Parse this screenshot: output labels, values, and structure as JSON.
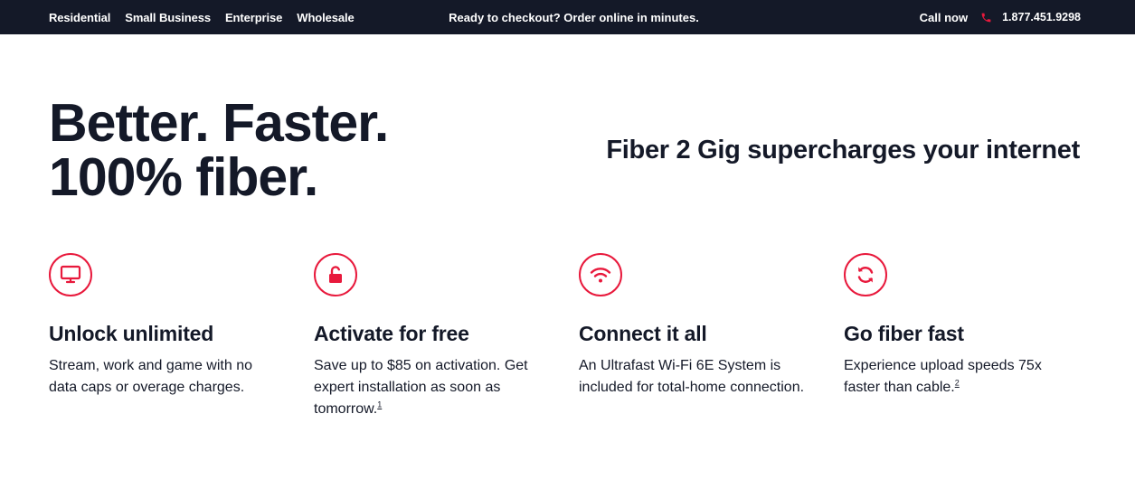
{
  "topbar": {
    "nav": [
      "Residential",
      "Small Business",
      "Enterprise",
      "Wholesale"
    ],
    "promo": "Ready to checkout? Order online in minutes.",
    "call_label": "Call now",
    "phone": "1.877.451.9298"
  },
  "hero": {
    "title_line1": "Better. Faster.",
    "title_line2": "100% fiber.",
    "subtitle": "Fiber 2 Gig supercharges your internet"
  },
  "features": [
    {
      "icon": "monitor-icon",
      "title": "Unlock unlimited",
      "text": "Stream, work and game with no data caps or overage charges.",
      "footnote": ""
    },
    {
      "icon": "unlock-icon",
      "title": "Activate for free",
      "text": "Save up to $85 on activation. Get expert installation as soon as tomorrow.",
      "footnote": "1"
    },
    {
      "icon": "wifi-icon",
      "title": "Connect it all",
      "text": "An Ultrafast Wi-Fi 6E System is included for total-home connection.",
      "footnote": ""
    },
    {
      "icon": "refresh-icon",
      "title": "Go fiber fast",
      "text": "Experience upload speeds 75x faster than cable.",
      "footnote": "2"
    }
  ],
  "colors": {
    "accent": "#e8193c",
    "navy": "#141928",
    "background": "#ffffff"
  }
}
